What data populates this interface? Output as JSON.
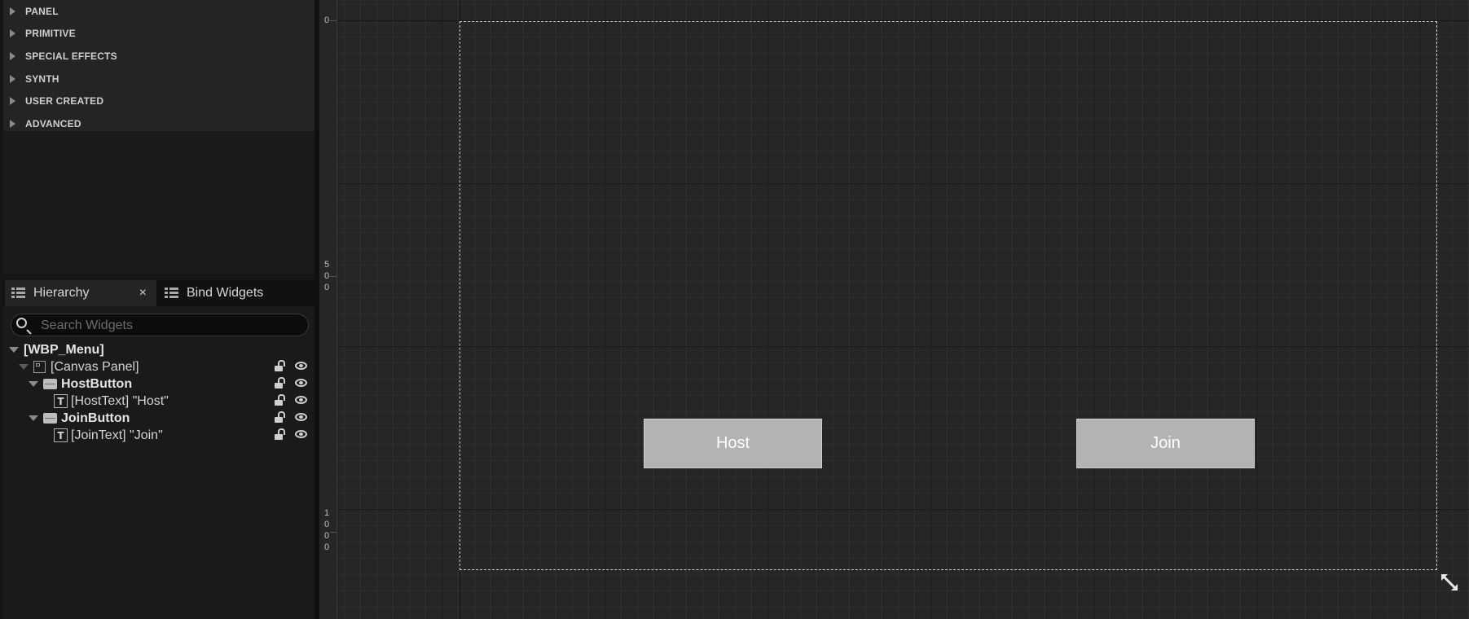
{
  "palette": {
    "categories": [
      {
        "label": "PANEL"
      },
      {
        "label": "PRIMITIVE"
      },
      {
        "label": "SPECIAL EFFECTS"
      },
      {
        "label": "SYNTH"
      },
      {
        "label": "USER CREATED"
      },
      {
        "label": "ADVANCED"
      }
    ]
  },
  "hierarchy": {
    "tabs": [
      {
        "label": "Hierarchy",
        "close": "×"
      },
      {
        "label": "Bind Widgets"
      }
    ],
    "search": {
      "placeholder": "Search Widgets",
      "value": ""
    },
    "tree": [
      {
        "label": "[WBP_Menu]",
        "icon": "none"
      },
      {
        "label": "[Canvas Panel]",
        "icon": "canvas-panel-icon"
      },
      {
        "label": "HostButton",
        "icon": "button-icon"
      },
      {
        "label": "[HostText] \"Host\"",
        "icon": "text-icon",
        "icon_glyph": "T"
      },
      {
        "label": "JoinButton",
        "icon": "button-icon"
      },
      {
        "label": "[JoinText] \"Join\"",
        "icon": "text-icon",
        "icon_glyph": "T"
      }
    ]
  },
  "designer": {
    "ruler_labels": {
      "zero": "0",
      "five_hundred": [
        "5",
        "0",
        "0"
      ],
      "one_thousand": [
        "1",
        "0",
        "0",
        "0"
      ]
    },
    "buttons": {
      "host": "Host",
      "join": "Join"
    },
    "button_color": "#b3b3b3"
  }
}
